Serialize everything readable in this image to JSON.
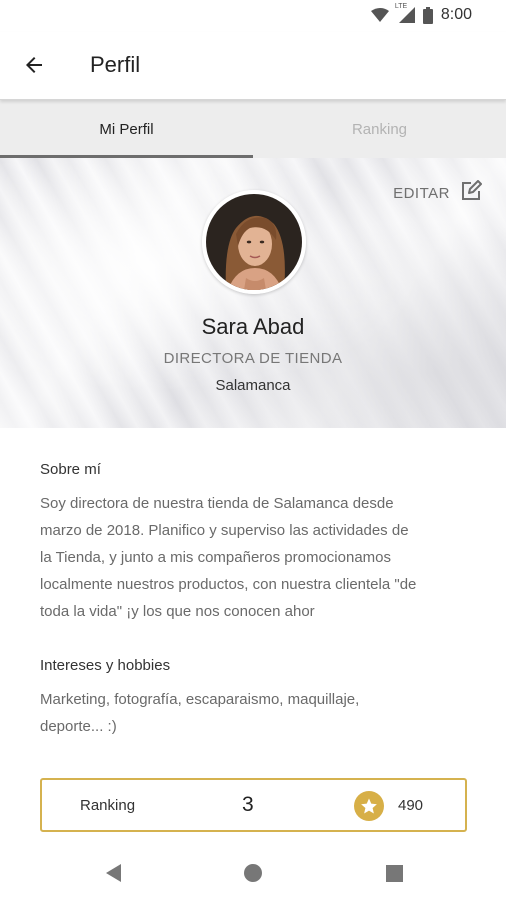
{
  "status_bar": {
    "time": "8:00",
    "network_label": "LTE",
    "icons": [
      "wifi-icon",
      "signal-icon",
      "battery-icon"
    ]
  },
  "app_bar": {
    "title": "Perfil",
    "back_icon": "arrow-back-icon"
  },
  "tabs": [
    {
      "label": "Mi Perfil",
      "active": true
    },
    {
      "label": "Ranking",
      "active": false
    }
  ],
  "profile": {
    "edit_label": "EDITAR",
    "edit_icon": "edit-icon",
    "name": "Sara Abad",
    "role": "DIRECTORA DE TIENDA",
    "city": "Salamanca"
  },
  "about": {
    "title": "Sobre mí",
    "lines": [
      "Soy directora de nuestra tienda de Salamanca desde",
      "marzo de 2018. Planifico y superviso las actividades de",
      "la Tienda, y junto a mis compañeros promocionamos",
      "localmente nuestros productos, con nuestra clientela \"de",
      "toda la vida\" ¡y los que nos conocen ahor"
    ]
  },
  "interests": {
    "title": "Intereses y hobbies",
    "lines": [
      "Marketing, fotografía, escaparaismo, maquillaje,",
      "deporte... :)"
    ]
  },
  "ranking": {
    "label": "Ranking",
    "position": "3",
    "points": "490",
    "star_icon": "star-icon"
  },
  "colors": {
    "accent_gold": "#d7af47",
    "card_border": "#d5b24f",
    "tab_background": "#ededed"
  },
  "nav_bar": {
    "icons": [
      "nav-back-icon",
      "nav-home-icon",
      "nav-recents-icon"
    ]
  }
}
